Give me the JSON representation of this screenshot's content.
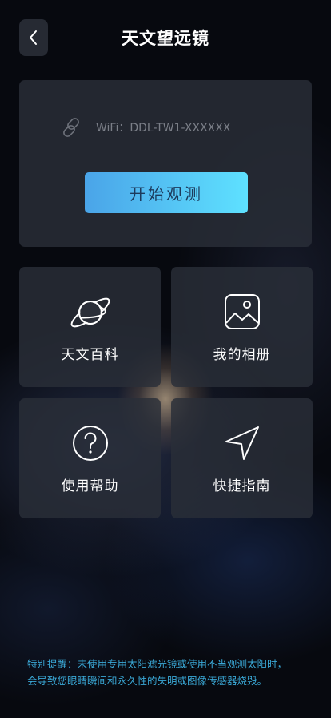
{
  "header": {
    "title": "天文望远镜",
    "back_icon": "chevron-left-icon"
  },
  "connection": {
    "link_icon": "link-icon",
    "wifi_text": "WiFi：DDL-TW1-XXXXXX",
    "start_label": "开始观测"
  },
  "menu": {
    "items": [
      {
        "label": "天文百科",
        "icon": "planet-icon"
      },
      {
        "label": "我的相册",
        "icon": "image-icon"
      },
      {
        "label": "使用帮助",
        "icon": "help-circle-icon"
      },
      {
        "label": "快捷指南",
        "icon": "navigation-arrow-icon"
      }
    ]
  },
  "warning": {
    "line1": "特别提醒：未使用专用太阳滤光镜或使用不当观测太阳时，",
    "line2": "会导致您眼睛瞬间和永久性的失明或图像传感器烧毁。"
  },
  "colors": {
    "accent_start": "#4aa4e8",
    "accent_end": "#5ee1ff",
    "warning_text": "#3aa8d6",
    "card_bg": "#2a2e38"
  }
}
